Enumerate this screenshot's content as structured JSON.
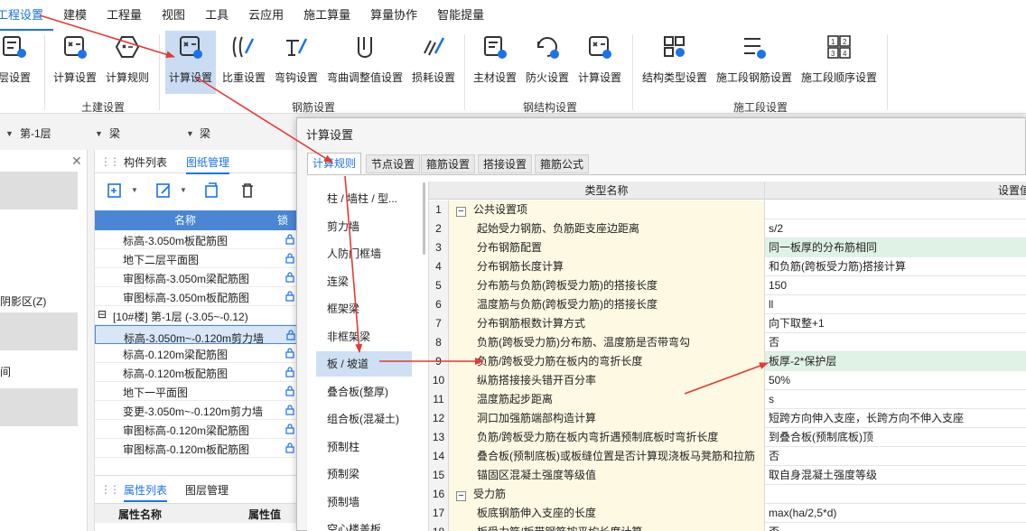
{
  "menu": [
    "工程设置",
    "建模",
    "工程量",
    "视图",
    "工具",
    "云应用",
    "施工算量",
    "算量协作",
    "智能提量"
  ],
  "ribbon": {
    "buttons": [
      {
        "label": "层设置",
        "icon": "floor-settings-icon"
      },
      {
        "label": "计算设置",
        "icon": "calc-settings-icon"
      },
      {
        "label": "计算规则",
        "icon": "calc-rules-icon"
      },
      {
        "label": "计算设置",
        "icon": "calc-settings-icon"
      },
      {
        "label": "比重设置",
        "icon": "density-settings-icon"
      },
      {
        "label": "弯钩设置",
        "icon": "hook-settings-icon"
      },
      {
        "label": "弯曲调整值设置",
        "icon": "bend-adjust-icon"
      },
      {
        "label": "损耗设置",
        "icon": "loss-settings-icon"
      },
      {
        "label": "主材设置",
        "icon": "main-material-icon"
      },
      {
        "label": "防火设置",
        "icon": "fireproof-icon"
      },
      {
        "label": "计算设置",
        "icon": "calc-settings-icon"
      },
      {
        "label": "结构类型设置",
        "icon": "structure-type-icon"
      },
      {
        "label": "施工段钢筋设置",
        "icon": "segment-rebar-icon"
      },
      {
        "label": "施工段顺序设置",
        "icon": "segment-order-icon"
      }
    ],
    "groups": [
      "土建设置",
      "钢筋设置",
      "钢结构设置",
      "施工段设置"
    ]
  },
  "selectors": {
    "floor": "第-1层",
    "type1": "梁",
    "type2": "梁"
  },
  "left_panel": {
    "item1": "阴影区(Z)",
    "item2": "间"
  },
  "mid_panel": {
    "tabs": [
      "构件列表",
      "图纸管理"
    ],
    "headers": {
      "name": "名称",
      "lock": "锁定"
    },
    "rows": [
      {
        "text": "标高-3.050m板配筋图",
        "group": false
      },
      {
        "text": "地下二层平面图",
        "group": false
      },
      {
        "text": "审图标高-3.050m梁配筋图",
        "group": false
      },
      {
        "text": "审图标高-3.050m板配筋图",
        "group": false
      },
      {
        "text": "[10#楼] 第-1层 (-3.05~-0.12)",
        "group": true
      },
      {
        "text": "标高-3.050m~-0.120m剪力墙",
        "group": false,
        "selected": true
      },
      {
        "text": "标高-0.120m梁配筋图",
        "group": false
      },
      {
        "text": "标高-0.120m板配筋图",
        "group": false
      },
      {
        "text": "地下一平面图",
        "group": false
      },
      {
        "text": "变更-3.050m~-0.120m剪力墙",
        "group": false
      },
      {
        "text": "审图标高-0.120m梁配筋图",
        "group": false
      },
      {
        "text": "审图标高-0.120m板配筋图",
        "group": false
      }
    ],
    "props_tabs": [
      "属性列表",
      "图层管理"
    ],
    "props_headers": {
      "name": "属性名称",
      "value": "属性值"
    }
  },
  "dialog": {
    "title": "计算设置",
    "tabs": [
      "计算规则",
      "节点设置",
      "箍筋设置",
      "搭接设置",
      "箍筋公式"
    ],
    "categories": [
      "柱 / 墙柱 / 型...",
      "剪力墙",
      "人防门框墙",
      "连梁",
      "框架梁",
      "非框架梁",
      "板 / 坡道",
      "叠合板(整厚)",
      "组合板(混凝土)",
      "预制柱",
      "预制梁",
      "预制墙",
      "空心楼盖板"
    ],
    "active_category_index": 6,
    "grid_headers": {
      "name": "类型名称",
      "value": "设置值"
    },
    "rows": [
      {
        "num": "1",
        "name": "公共设置项",
        "value": "",
        "section": true
      },
      {
        "num": "2",
        "name": "起始受力钢筋、负筋距支座边距离",
        "value": "s/2"
      },
      {
        "num": "3",
        "name": "分布钢筋配置",
        "value": "同一板厚的分布筋相同",
        "green": true
      },
      {
        "num": "4",
        "name": "分布钢筋长度计算",
        "value": "和负筋(跨板受力筋)搭接计算"
      },
      {
        "num": "5",
        "name": "分布筋与负筋(跨板受力筋)的搭接长度",
        "value": "150"
      },
      {
        "num": "6",
        "name": "温度筋与负筋(跨板受力筋)的搭接长度",
        "value": "ll"
      },
      {
        "num": "7",
        "name": "分布钢筋根数计算方式",
        "value": "向下取整+1"
      },
      {
        "num": "8",
        "name": "负筋(跨板受力筋)分布筋、温度筋是否带弯勾",
        "value": "否"
      },
      {
        "num": "9",
        "name": "负筋/跨板受力筋在板内的弯折长度",
        "value": "板厚-2*保护层",
        "green": true
      },
      {
        "num": "10",
        "name": "纵筋搭接接头错开百分率",
        "value": "50%"
      },
      {
        "num": "11",
        "name": "温度筋起步距离",
        "value": "s"
      },
      {
        "num": "12",
        "name": "洞口加强筋端部构造计算",
        "value": "短跨方向伸入支座，长跨方向不伸入支座"
      },
      {
        "num": "13",
        "name": "负筋/跨板受力筋在板内弯折遇预制底板时弯折长度",
        "value": "到叠合板(预制底板)顶"
      },
      {
        "num": "14",
        "name": "叠合板(预制底板)或板缝位置是否计算现浇板马凳筋和拉筋",
        "value": "否"
      },
      {
        "num": "15",
        "name": "锚固区混凝土强度等级值",
        "value": "取自身混凝土强度等级"
      },
      {
        "num": "16",
        "name": "受力筋",
        "value": "",
        "section": true
      },
      {
        "num": "17",
        "name": "板底钢筋伸入支座的长度",
        "value": "max(ha/2,5*d)"
      },
      {
        "num": "18",
        "name": "板受力筋/板带钢筋按平均长度计算",
        "value": "否"
      }
    ]
  },
  "colors": {
    "accent": "#1a73e8",
    "arrow": "#e53935",
    "header_blue": "#4a86d4",
    "name_bg": "#fdf9e3",
    "green_bg": "#e0f2e6"
  }
}
